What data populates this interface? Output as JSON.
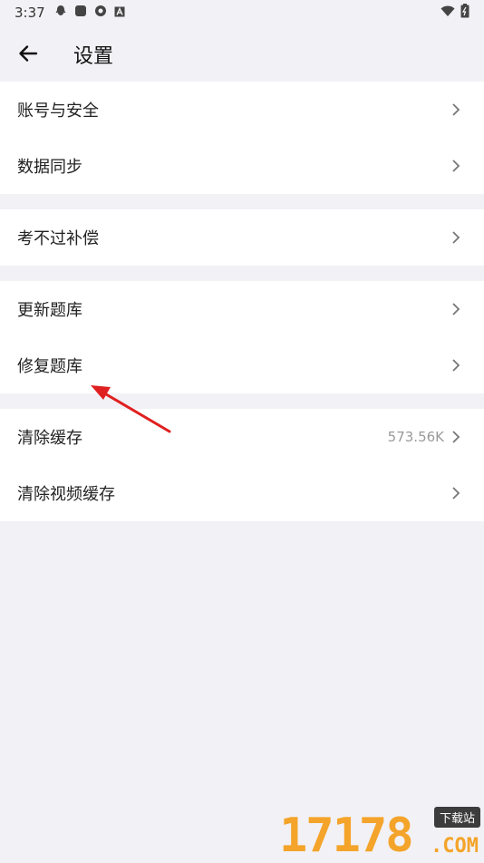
{
  "status_bar": {
    "time": "3:37"
  },
  "header": {
    "title": "设置"
  },
  "groups": [
    {
      "items": [
        {
          "label": "账号与安全"
        },
        {
          "label": "数据同步"
        }
      ]
    },
    {
      "items": [
        {
          "label": "考不过补偿"
        }
      ]
    },
    {
      "items": [
        {
          "label": "更新题库"
        },
        {
          "label": "修复题库"
        }
      ]
    },
    {
      "items": [
        {
          "label": "清除缓存",
          "value": "573.56K"
        },
        {
          "label": "清除视频缓存"
        }
      ]
    }
  ],
  "watermark": {
    "number": "17178",
    "tag": "下载站",
    "suffix": ".COM"
  },
  "colors": {
    "background": "#f2f1f6",
    "card": "#ffffff",
    "arrow": "#e02020",
    "watermark": "#f4a42a"
  }
}
